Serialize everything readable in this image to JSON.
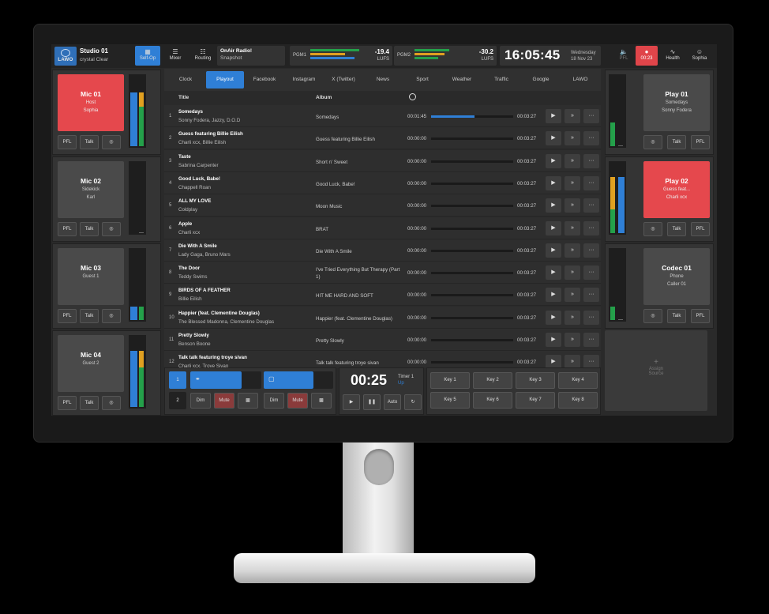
{
  "header": {
    "logo": "LAWO",
    "studio_name": "Studio 01",
    "studio_profile": "crystal Clear",
    "buttons": [
      {
        "label": "Self-Op",
        "icon": "layout-icon",
        "active": true
      },
      {
        "label": "Mixer",
        "icon": "faders-icon"
      },
      {
        "label": "Routing",
        "icon": "routing-icon"
      }
    ],
    "onair_title": "OnAir Radio!",
    "onair_sub": "Snapshot",
    "pgm1": {
      "label": "PGM1",
      "value": "-19.4",
      "unit": "LUFS"
    },
    "pgm2": {
      "label": "PGM2",
      "value": "-30.2",
      "unit": "LUFS"
    },
    "clock": "16:05:45",
    "weekday": "Wednesday",
    "date": "18 Nov 23",
    "pfl_label": "PFL",
    "live_time": "00:23",
    "health_label": "Health",
    "user_name": "Sophia"
  },
  "left_channels": [
    {
      "name": "Mic 01",
      "line1": "Host",
      "line2": "Sophia",
      "state": "live",
      "level": 0.78,
      "level2": 0.78,
      "buttons": [
        "PFL",
        "Talk"
      ]
    },
    {
      "name": "Mic 02",
      "line1": "Sidekick",
      "line2": "Karl",
      "state": "off",
      "level": 0.0,
      "level2": 0.0,
      "buttons": [
        "PFL",
        "Talk"
      ]
    },
    {
      "name": "Mic 03",
      "line1": "Guest 1",
      "line2": "",
      "state": "off",
      "level": 0.2,
      "level2": 0.2,
      "buttons": [
        "PFL",
        "Talk"
      ]
    },
    {
      "name": "Mic 04",
      "line1": "Guest 2",
      "line2": "",
      "state": "off",
      "level": 0.82,
      "level2": 0.82,
      "buttons": [
        "PFL",
        "Talk"
      ]
    }
  ],
  "right_channels": [
    {
      "name": "Play 01",
      "line1": "Somedays",
      "line2": "Sonny Fodera",
      "state": "off",
      "level": 0.35,
      "buttons": [
        "Talk",
        "PFL"
      ]
    },
    {
      "name": "Play 02",
      "line1": "Guess feat...",
      "line2": "Charli xcx",
      "state": "live",
      "level": 0.82,
      "buttons": [
        "Talk",
        "PFL"
      ]
    },
    {
      "name": "Codec 01",
      "line1": "Phone",
      "line2": "Caller 01",
      "state": "off",
      "level": 0.2,
      "buttons": [
        "Talk",
        "PFL"
      ]
    }
  ],
  "assign": {
    "plus": "+",
    "line1": "Assign",
    "line2": "Source"
  },
  "tabs": [
    {
      "label": "Clock"
    },
    {
      "label": "Playout",
      "active": true
    },
    {
      "label": "Facebook"
    },
    {
      "label": "Instagram"
    },
    {
      "label": "X (Twitter)"
    },
    {
      "label": "News"
    },
    {
      "label": "Sport"
    },
    {
      "label": "Weather"
    },
    {
      "label": "Traffic"
    },
    {
      "label": "Google"
    },
    {
      "label": "LAWO"
    }
  ],
  "table": {
    "col_title": "Title",
    "col_album": "Album",
    "rows": [
      {
        "no": "1",
        "title": "Somedays",
        "artist": "Sonny Fodera, Jazzy, D.O.D",
        "album": "Somedays",
        "elapsed": "00:01:45",
        "progress": 0.53,
        "duration": "00:03:27"
      },
      {
        "no": "2",
        "title": "Guess featuring Billie Eilish",
        "artist": "Charli xcx, Billie Eilish",
        "album": "Guess featuring Billie Eilish",
        "elapsed": "00:00:00",
        "progress": 0,
        "duration": "00:03:27"
      },
      {
        "no": "3",
        "title": "Taste",
        "artist": "Sabrina Carpenter",
        "album": "Short n' Sweet",
        "elapsed": "00:00:00",
        "progress": 0,
        "duration": "00:03:27"
      },
      {
        "no": "4",
        "title": "Good Luck, Babe!",
        "artist": "Chappell Roan",
        "album": "Good Luck, Babe!",
        "elapsed": "00:00:00",
        "progress": 0,
        "duration": "00:03:27"
      },
      {
        "no": "5",
        "title": "ALL MY LOVE",
        "artist": "Coldplay",
        "album": "Moon Music",
        "elapsed": "00:00:00",
        "progress": 0,
        "duration": "00:03:27"
      },
      {
        "no": "6",
        "title": "Apple",
        "artist": "Charli xcx",
        "album": "BRAT",
        "elapsed": "00:00:00",
        "progress": 0,
        "duration": "00:03:27"
      },
      {
        "no": "7",
        "title": "Die With A Smile",
        "artist": "Lady Gaga, Bruno Mars",
        "album": "Die With A Smile",
        "elapsed": "00:00:00",
        "progress": 0,
        "duration": "00:03:27"
      },
      {
        "no": "8",
        "title": "The Door",
        "artist": "Teddy Swims",
        "album": "I've Tried Everything But Therapy (Part 1)",
        "elapsed": "00:00:00",
        "progress": 0,
        "duration": "00:03:27"
      },
      {
        "no": "9",
        "title": "BIRDS OF A FEATHER",
        "artist": "Billie Eilish",
        "album": "HIT ME HARD AND SOFT",
        "elapsed": "00:00:00",
        "progress": 0,
        "duration": "00:03:27"
      },
      {
        "no": "10",
        "title": "Happier (feat. Clementine Douglas)",
        "artist": "The Blessed Madonna, Clementine Douglas",
        "album": "Happier (feat. Clementine Douglas)",
        "elapsed": "00:00:00",
        "progress": 0,
        "duration": "00:03:27"
      },
      {
        "no": "11",
        "title": "Pretty Slowly",
        "artist": "Benson Boone",
        "album": "Pretty Slowly",
        "elapsed": "00:00:00",
        "progress": 0,
        "duration": "00:03:27"
      },
      {
        "no": "12",
        "title": "Talk talk featuring troye sivan",
        "artist": "Charli xcx, Troye Sivan",
        "album": "Talk talk featuring troye sivan",
        "elapsed": "00:00:00",
        "progress": 0,
        "duration": "00:03:27"
      }
    ]
  },
  "monitor": {
    "sel1": "1",
    "sel2": "2",
    "dim": "Dim",
    "mute": "Mute",
    "headphone_level": 0.72,
    "speaker_level": 0.72
  },
  "timer": {
    "time": "00:25",
    "name": "Timer 1",
    "mode": "Up",
    "auto": "Auto"
  },
  "keys": [
    "Key 1",
    "Key 2",
    "Key 3",
    "Key 4",
    "Key 5",
    "Key 6",
    "Key 7",
    "Key 8"
  ],
  "colors": {
    "accent": "#2f7fd6",
    "live": "#e5484d",
    "meter_green": "#24a04a",
    "meter_yellow": "#e0a020"
  }
}
